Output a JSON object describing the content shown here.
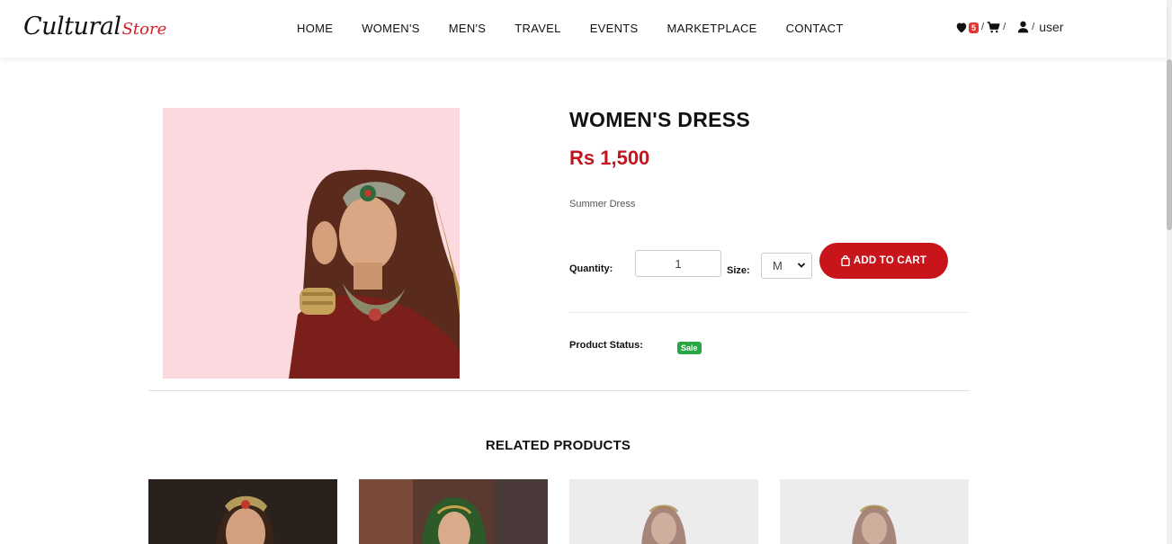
{
  "header": {
    "logo_main": "Cultural",
    "logo_sub": "Store",
    "nav": [
      "HOME",
      "WOMEN'S",
      "MEN'S",
      "TRAVEL",
      "EVENTS",
      "MARKETPLACE",
      "CONTACT"
    ],
    "wishlist_count": "5",
    "sep1": "/",
    "sep2": "/",
    "sep3": "/",
    "user_label": "user"
  },
  "product": {
    "title": "WOMEN'S DRESS",
    "price": "Rs 1,500",
    "description": "Summer Dress",
    "quantity_label": "Quantity:",
    "quantity_value": "1",
    "size_label": "Size:",
    "size_value": "M",
    "add_to_cart_label": "ADD TO CART",
    "status_label": "Product Status:",
    "status_value": "Sale"
  },
  "related": {
    "title": "RELATED PRODUCTS"
  },
  "colors": {
    "accent": "#c8141b",
    "price": "#c0161e",
    "status_badge": "#28a745",
    "image_bg": "#fcd9df"
  }
}
